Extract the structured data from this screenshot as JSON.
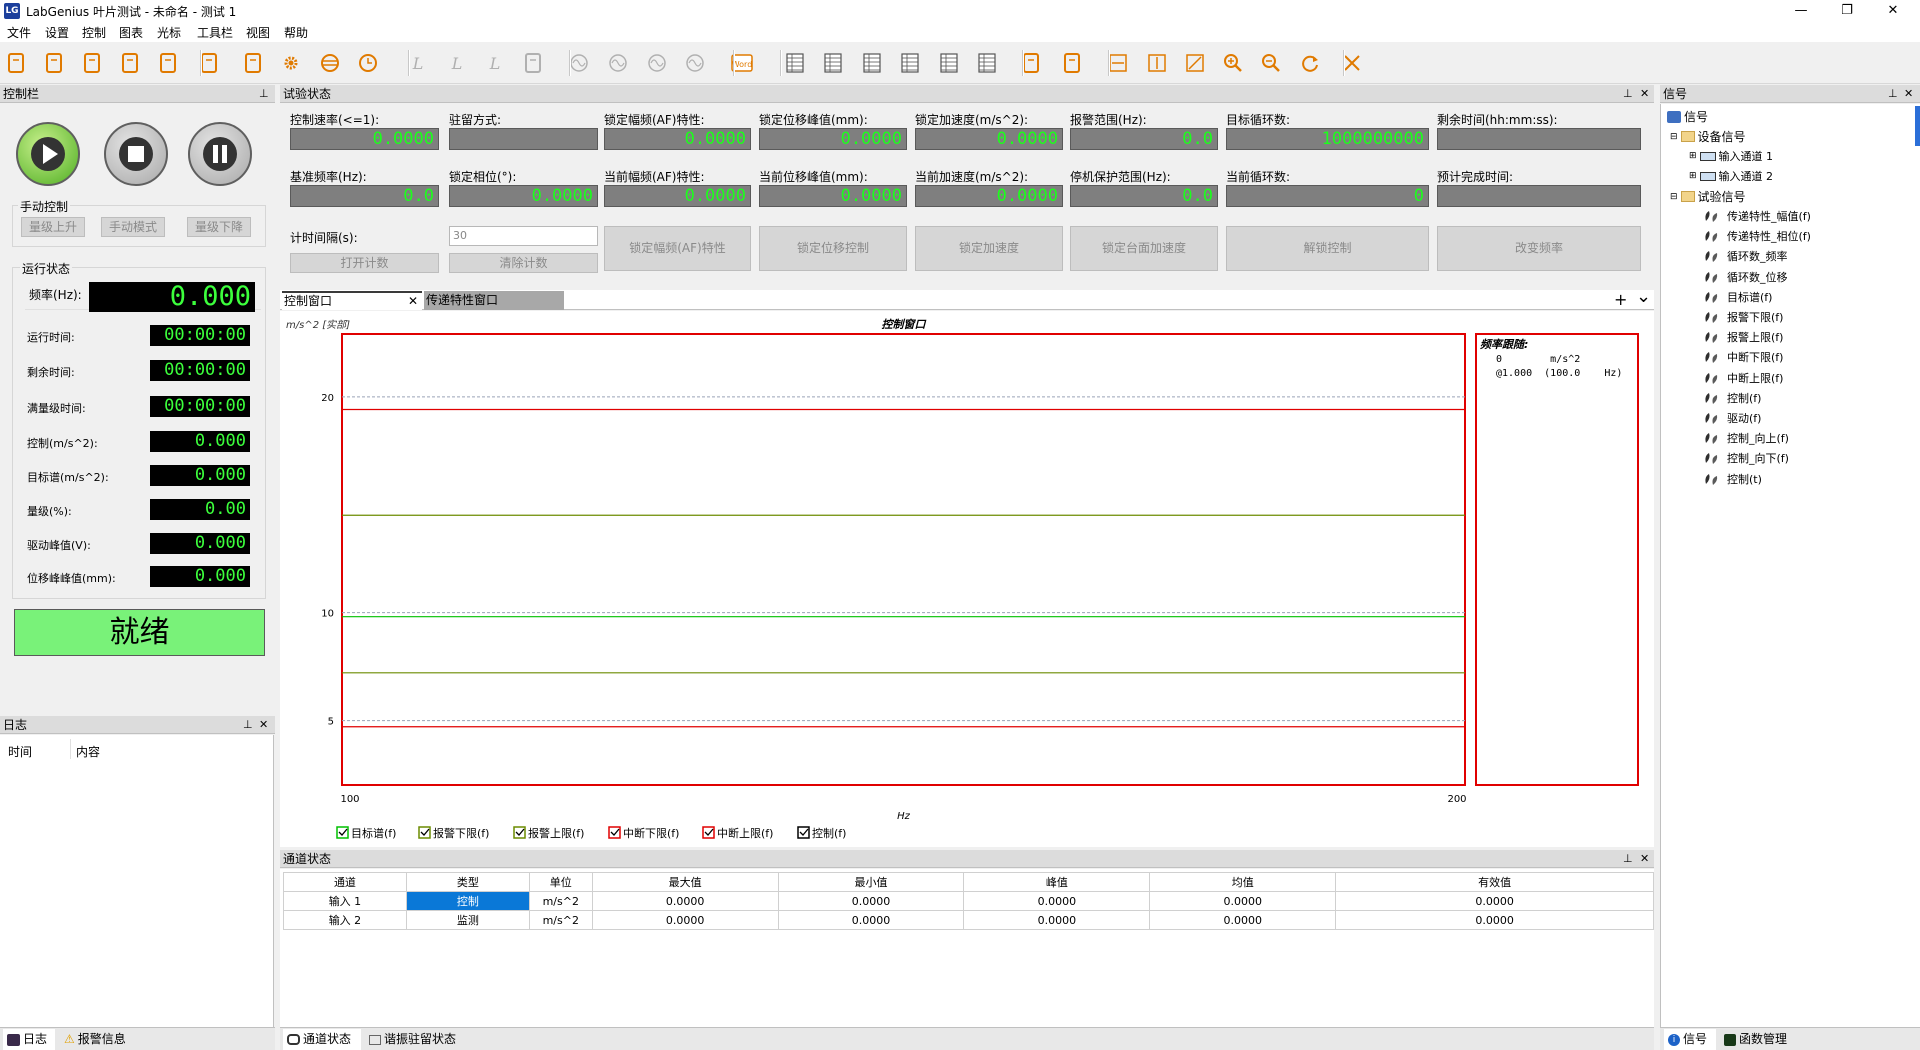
{
  "app": {
    "icon_text": "LG",
    "title": "LabGenius 叶片测试 - 未命名 - 测试 1"
  },
  "window_controls": {
    "minimize": "—",
    "maximize": "❐",
    "close": "✕"
  },
  "menu": [
    "文件",
    "设置",
    "控制",
    "图表",
    "光标",
    "工具栏",
    "视图",
    "帮助"
  ],
  "toolbar_icons": [
    "new-file-icon",
    "save-icon",
    "save-as-icon",
    "open-folder-icon",
    "export-icon",
    "clipboard-icon",
    "report-icon",
    "settings-gear-icon",
    "sweep-icon",
    "clock-icon",
    "cursor-l-icon",
    "cursor-l-plus-icon",
    "cursor-l-minus-icon",
    "copy-icon",
    "wave1-icon",
    "wave2-icon",
    "wave3-icon",
    "wave4-icon",
    "word-export-icon",
    "table1-icon",
    "table2-icon",
    "table3-icon",
    "table4-icon",
    "table5-icon",
    "chart-icon",
    "layout1-icon",
    "layout2-icon",
    "fit-horizontal-icon",
    "fit-vertical-icon",
    "fit-diagonal-icon",
    "zoom-in-icon",
    "zoom-out-icon",
    "refresh-icon",
    "reset-zoom-icon"
  ],
  "word_label": "Word",
  "control_panel": {
    "title": "控制栏",
    "manual": {
      "title": "手动控制",
      "buttons": [
        "量级上升",
        "手动模式",
        "量级下降"
      ]
    },
    "run_status": {
      "title": "运行状态",
      "freq_label": "频率(Hz):",
      "freq_value": "0.000",
      "rows": [
        {
          "label": "运行时间:",
          "value": "00:00:00"
        },
        {
          "label": "剩余时间:",
          "value": "00:00:00"
        },
        {
          "label": "满量级时间:",
          "value": "00:00:00"
        },
        {
          "label": "控制(m/s^2):",
          "value": "0.000"
        },
        {
          "label": "目标谱(m/s^2):",
          "value": "0.000"
        },
        {
          "label": "量级(%):",
          "value": "0.00"
        },
        {
          "label": "驱动峰值(V):",
          "value": "0.000"
        },
        {
          "label": "位移峰峰值(mm):",
          "value": "0.000"
        }
      ]
    },
    "ready": "就绪"
  },
  "log_panel": {
    "title": "日志",
    "col_time": "时间",
    "col_content": "内容"
  },
  "test_status": {
    "title": "试验状态",
    "row1": [
      {
        "label": "控制速率(<=1):",
        "value": "0.0000"
      },
      {
        "label": "驻留方式:",
        "value": ""
      },
      {
        "label": "锁定幅频(AF)特性:",
        "value": "0.0000"
      },
      {
        "label": "锁定位移峰值(mm):",
        "value": "0.0000"
      },
      {
        "label": "锁定加速度(m/s^2):",
        "value": "0.0000"
      },
      {
        "label": "报警范围(Hz):",
        "value": "0.0"
      },
      {
        "label": "目标循环数:",
        "value": "1000000000"
      },
      {
        "label": "剩余时间(hh:mm:ss):",
        "value": ""
      }
    ],
    "row2": [
      {
        "label": "基准频率(Hz):",
        "value": "0.0"
      },
      {
        "label": "锁定相位(°):",
        "value": "0.0000"
      },
      {
        "label": "当前幅频(AF)特性:",
        "value": "0.0000"
      },
      {
        "label": "当前位移峰值(mm):",
        "value": "0.0000"
      },
      {
        "label": "当前加速度(m/s^2):",
        "value": "0.0000"
      },
      {
        "label": "停机保护范围(Hz):",
        "value": "0.0"
      },
      {
        "label": "当前循环数:",
        "value": "0"
      },
      {
        "label": "预计完成时间:",
        "value": ""
      }
    ],
    "interval_label": "计时间隔(s):",
    "interval_value": "30",
    "buttons": [
      "打开计数",
      "清除计数",
      "锁定幅频(AF)特性",
      "锁定位移控制",
      "锁定加速度",
      "锁定台面加速度",
      "解锁控制",
      "改变频率"
    ]
  },
  "tabs": {
    "control_window": "控制窗口",
    "transfer_window": "传递特性窗口",
    "add": "+",
    "menu": "⌄"
  },
  "chart_data": {
    "type": "line",
    "title": "控制窗口",
    "ylabel": "m/s^2 [实部]",
    "xlabel": "Hz",
    "x_ticks": [
      "100",
      "200"
    ],
    "y_ticks": [
      "20",
      "10",
      "5"
    ],
    "xlim": [
      100,
      200
    ],
    "series": [
      {
        "name": "目标谱(f)",
        "color": "#00c000",
        "y": 10
      },
      {
        "name": "报警下限(f)",
        "color": "#6c8c00",
        "y": 7.4
      },
      {
        "name": "报警上限(f)",
        "color": "#6c8c00",
        "y": 14.7
      },
      {
        "name": "中断下限(f)",
        "color": "#e00000",
        "y": 4.9
      },
      {
        "name": "中断上限(f)",
        "color": "#e00000",
        "y": 19.6
      },
      {
        "name": "控制(f)",
        "color": "#000000"
      }
    ],
    "legend_position": "bottom",
    "side_title": "频率跟随:",
    "side_line1": "0        m/s^2",
    "side_line2": "@1.000  (100.0    Hz)"
  },
  "channel_status": {
    "title": "通道状态",
    "columns": [
      "通道",
      "类型",
      "单位",
      "最大值",
      "最小值",
      "峰值",
      "均值",
      "有效值"
    ],
    "rows": [
      [
        "输入 1",
        "控制",
        "m/s^2",
        "0.0000",
        "0.0000",
        "0.0000",
        "0.0000",
        "0.0000"
      ],
      [
        "输入 2",
        "监测",
        "m/s^2",
        "0.0000",
        "0.0000",
        "0.0000",
        "0.0000",
        "0.0000"
      ]
    ]
  },
  "signals": {
    "title": "信号",
    "root": "信号",
    "device_group": "设备信号",
    "device_items": [
      "输入通道 1",
      "输入通道 2"
    ],
    "test_group": "试验信号",
    "test_items": [
      "传递特性_幅值(f)",
      "传递特性_相位(f)",
      "循环数_频率",
      "循环数_位移",
      "目标谱(f)",
      "报警下限(f)",
      "报警上限(f)",
      "中断下限(f)",
      "中断上限(f)",
      "控制(f)",
      "驱动(f)",
      "控制_向上(f)",
      "控制_向下(f)",
      "控制(t)"
    ]
  },
  "bottom_tabs": {
    "log": "日志",
    "alarm": "报警信息",
    "channel": "通道状态",
    "resonance": "谐振驻留状态",
    "signal": "信号",
    "function": "函数管理"
  }
}
